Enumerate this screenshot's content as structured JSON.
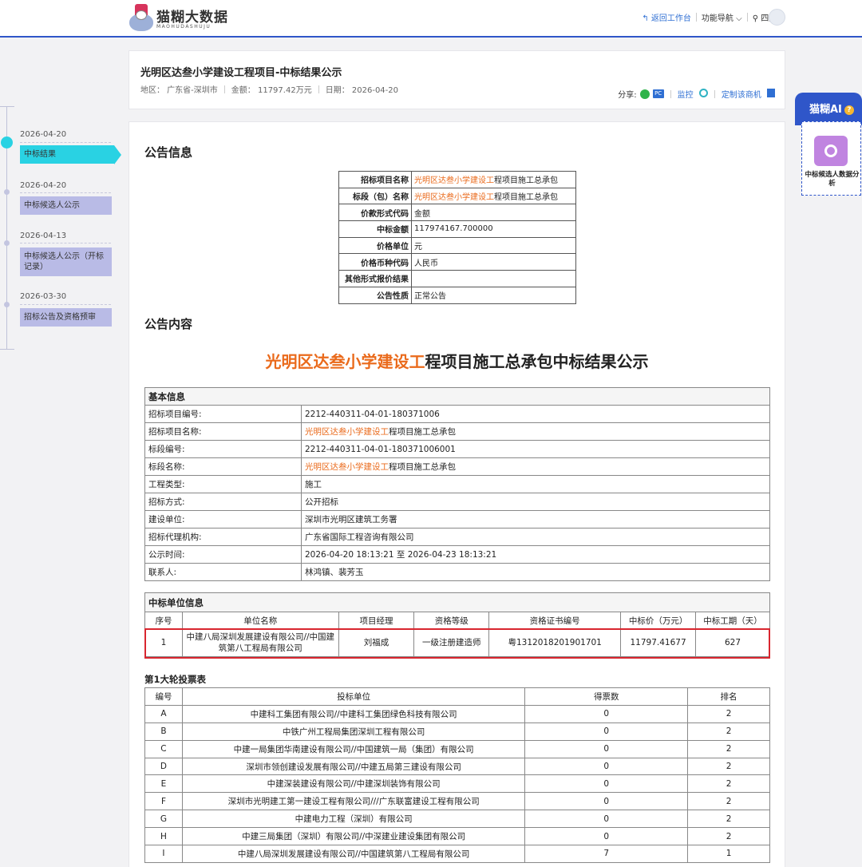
{
  "header": {
    "logo_cn": "猫糊大数据",
    "logo_en": "MAOHUDASHUJU",
    "back_label": "返回工作台",
    "nav_label": "功能导航",
    "region_label": "四川"
  },
  "timeline": [
    {
      "date": "2026-04-20",
      "label": "中标结果",
      "active": true
    },
    {
      "date": "2026-04-20",
      "label": "中标候选人公示",
      "active": false
    },
    {
      "date": "2026-04-13",
      "label": "中标候选人公示（开标记录）",
      "active": false
    },
    {
      "date": "2026-03-30",
      "label": "招标公告及资格预审",
      "active": false
    }
  ],
  "notice": {
    "title": "光明区达叁小学建设工程项目-中标结果公示",
    "region": "地区： 广东省-深圳市",
    "amount": "金额： 11797.42万元",
    "date": "日期： 2026-04-20",
    "share_label": "分享:",
    "pc_label": "PC",
    "monitor_label": "监控",
    "custom_label": "定制该商机"
  },
  "announcement_info": {
    "section_title": "公告信息",
    "rows": [
      {
        "k": "招标项目名称",
        "v_hl": "光明区达叁小学建设工",
        "v": "程项目施工总承包"
      },
      {
        "k": "标段（包）名称",
        "v_hl": "光明区达叁小学建设工",
        "v": "程项目施工总承包"
      },
      {
        "k": "价款形式代码",
        "v_hl": "",
        "v": "金额"
      },
      {
        "k": "中标金额",
        "v_hl": "",
        "v": "117974167.700000"
      },
      {
        "k": "价格单位",
        "v_hl": "",
        "v": "元"
      },
      {
        "k": "价格币种代码",
        "v_hl": "",
        "v": "人民币"
      },
      {
        "k": "其他形式报价结果",
        "v_hl": "",
        "v": ""
      },
      {
        "k": "公告性质",
        "v_hl": "",
        "v": "正常公告"
      }
    ]
  },
  "content": {
    "section_title": "公告内容",
    "big_title_hl": "光明区达叁小学建设工",
    "big_title": "程项目施工总承包中标结果公示"
  },
  "basic_info": {
    "header": "基本信息",
    "rows": [
      {
        "k": "招标项目编号:",
        "v_hl": "",
        "v": "2212-440311-04-01-180371006"
      },
      {
        "k": "招标项目名称:",
        "v_hl": "光明区达叁小学建设工",
        "v": "程项目施工总承包"
      },
      {
        "k": "标段编号:",
        "v_hl": "",
        "v": "2212-440311-04-01-180371006001"
      },
      {
        "k": "标段名称:",
        "v_hl": "光明区达叁小学建设工",
        "v": "程项目施工总承包"
      },
      {
        "k": "工程类型:",
        "v_hl": "",
        "v": "施工"
      },
      {
        "k": "招标方式:",
        "v_hl": "",
        "v": "公开招标"
      },
      {
        "k": "建设单位:",
        "v_hl": "",
        "v": "深圳市光明区建筑工务署"
      },
      {
        "k": "招标代理机构:",
        "v_hl": "",
        "v": "广东省国际工程咨询有限公司"
      },
      {
        "k": "公示时间:",
        "v_hl": "",
        "v": "2026-04-20 18:13:21 至 2026-04-23 18:13:21"
      },
      {
        "k": "联系人:",
        "v_hl": "",
        "v": "林鸿镇、裴芳玉"
      }
    ]
  },
  "winner": {
    "header": "中标单位信息",
    "columns": [
      "序号",
      "单位名称",
      "项目经理",
      "资格等级",
      "资格证书编号",
      "中标价（万元）",
      "中标工期（天）"
    ],
    "rows": [
      {
        "no": "1",
        "unit": "中建八局深圳发展建设有限公司//中国建筑第八工程局有限公司",
        "manager": "刘福成",
        "level": "一级注册建造师",
        "cert": "粤1312018201901701",
        "price": "11797.41677",
        "days": "627"
      }
    ]
  },
  "votes": {
    "title": "第1大轮投票表",
    "columns": [
      "编号",
      "投标单位",
      "得票数",
      "排名"
    ],
    "rows": [
      {
        "id": "A",
        "unit": "中建科工集团有限公司//中建科工集团绿色科技有限公司",
        "votes": "0",
        "rank": "2"
      },
      {
        "id": "B",
        "unit": "中铁广州工程局集团深圳工程有限公司",
        "votes": "0",
        "rank": "2"
      },
      {
        "id": "C",
        "unit": "中建一局集团华南建设有限公司//中国建筑一局（集团）有限公司",
        "votes": "0",
        "rank": "2"
      },
      {
        "id": "D",
        "unit": "深圳市领创建设发展有限公司//中建五局第三建设有限公司",
        "votes": "0",
        "rank": "2"
      },
      {
        "id": "E",
        "unit": "中建深装建设有限公司//中建深圳装饰有限公司",
        "votes": "0",
        "rank": "2"
      },
      {
        "id": "F",
        "unit": "深圳市光明建工第一建设工程有限公司///广东联富建设工程有限公司",
        "votes": "0",
        "rank": "2"
      },
      {
        "id": "G",
        "unit": "中建电力工程（深圳）有限公司",
        "votes": "0",
        "rank": "2"
      },
      {
        "id": "H",
        "unit": "中建三局集团（深圳）有限公司//中深建业建设集团有限公司",
        "votes": "0",
        "rank": "2"
      },
      {
        "id": "I",
        "unit": "中建八局深圳发展建设有限公司//中国建筑第八工程局有限公司",
        "votes": "7",
        "rank": "1"
      }
    ]
  },
  "ai_widget": {
    "title": "猫糊AI",
    "help": "?",
    "label": "中标候选人数据分析"
  },
  "colors": {
    "accent": "#2f56c9",
    "timeline_active": "#29d2e3",
    "highlight_text": "#ea6a1b",
    "winner_box": "#d9262f"
  }
}
